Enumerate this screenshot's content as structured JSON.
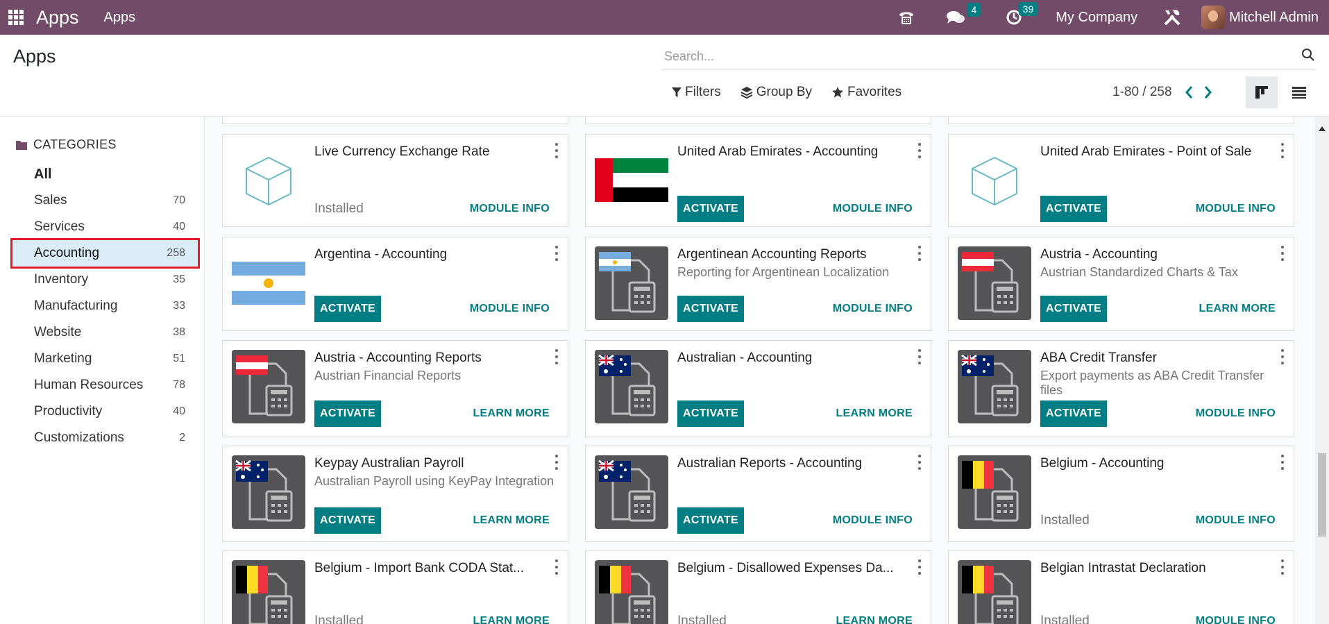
{
  "navbar": {
    "brand": "Apps",
    "menu": "Apps",
    "chat_count": "4",
    "activity_count": "39",
    "company": "My Company",
    "user": "Mitchell Admin"
  },
  "control": {
    "breadcrumb": "Apps",
    "search_placeholder": "Search...",
    "filters": "Filters",
    "group_by": "Group By",
    "favorites": "Favorites",
    "pager": "1-80 / 258"
  },
  "sidebar": {
    "header": "CATEGORIES",
    "items": [
      {
        "label": "All",
        "count": ""
      },
      {
        "label": "Sales",
        "count": "70"
      },
      {
        "label": "Services",
        "count": "40"
      },
      {
        "label": "Accounting",
        "count": "258"
      },
      {
        "label": "Inventory",
        "count": "35"
      },
      {
        "label": "Manufacturing",
        "count": "33"
      },
      {
        "label": "Website",
        "count": "38"
      },
      {
        "label": "Marketing",
        "count": "51"
      },
      {
        "label": "Human Resources",
        "count": "78"
      },
      {
        "label": "Productivity",
        "count": "40"
      },
      {
        "label": "Customizations",
        "count": "2"
      }
    ],
    "active": "Accounting"
  },
  "cards": [
    {
      "title": "Live Currency Exchange Rate",
      "subtitle": "",
      "status": "Installed",
      "link": "MODULE INFO",
      "icon": "cube-icon"
    },
    {
      "title": "United Arab Emirates - Accounting",
      "subtitle": "",
      "status": "ACTIVATE",
      "link": "MODULE INFO",
      "icon": "uae-flag-icon"
    },
    {
      "title": "United Arab Emirates - Point of Sale",
      "subtitle": "",
      "status": "ACTIVATE",
      "link": "MODULE INFO",
      "icon": "cube-icon"
    },
    {
      "title": "Argentina - Accounting",
      "subtitle": "",
      "status": "ACTIVATE",
      "link": "MODULE INFO",
      "icon": "argentina-flag-icon"
    },
    {
      "title": "Argentinean Accounting Reports",
      "subtitle": "Reporting for Argentinean Localization",
      "status": "ACTIVATE",
      "link": "MODULE INFO",
      "icon": "argentina-report-icon"
    },
    {
      "title": "Austria - Accounting",
      "subtitle": "Austrian Standardized Charts & Tax",
      "status": "ACTIVATE",
      "link": "LEARN MORE",
      "icon": "austria-report-icon"
    },
    {
      "title": "Austria - Accounting Reports",
      "subtitle": "Austrian Financial Reports",
      "status": "ACTIVATE",
      "link": "LEARN MORE",
      "icon": "austria-report-icon"
    },
    {
      "title": "Australian - Accounting",
      "subtitle": "",
      "status": "ACTIVATE",
      "link": "LEARN MORE",
      "icon": "australia-report-icon"
    },
    {
      "title": "ABA Credit Transfer",
      "subtitle": "Export payments as ABA Credit Transfer files",
      "status": "ACTIVATE",
      "link": "MODULE INFO",
      "icon": "australia-report-icon"
    },
    {
      "title": "Keypay Australian Payroll",
      "subtitle": "Australian Payroll using KeyPay Integration",
      "status": "ACTIVATE",
      "link": "LEARN MORE",
      "icon": "australia-report-icon"
    },
    {
      "title": "Australian Reports - Accounting",
      "subtitle": "",
      "status": "ACTIVATE",
      "link": "MODULE INFO",
      "icon": "australia-report-icon"
    },
    {
      "title": "Belgium - Accounting",
      "subtitle": "",
      "status": "Installed",
      "link": "MODULE INFO",
      "icon": "belgium-report-icon"
    },
    {
      "title": "Belgium - Import Bank CODA Stat...",
      "subtitle": "",
      "status": "Installed",
      "link": "LEARN MORE",
      "icon": "belgium-report-icon"
    },
    {
      "title": "Belgium - Disallowed Expenses Da...",
      "subtitle": "",
      "status": "Installed",
      "link": "LEARN MORE",
      "icon": "belgium-report-icon"
    },
    {
      "title": "Belgian Intrastat Declaration",
      "subtitle": "",
      "status": "Installed",
      "link": "MODULE INFO",
      "icon": "belgium-report-icon"
    }
  ]
}
